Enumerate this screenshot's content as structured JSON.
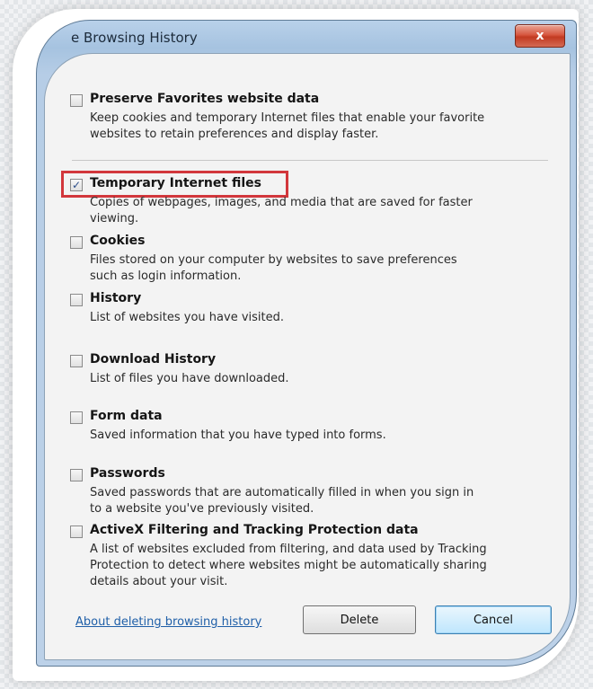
{
  "window": {
    "title": "e Browsing History",
    "close_label": "x"
  },
  "options": [
    {
      "label": "Preserve Favorites website data",
      "description": "Keep cookies and temporary Internet files that enable your favorite\nwebsites to retain preferences and display faster.",
      "checked": false
    },
    {
      "label": "Temporary Internet files",
      "description": "Copies of webpages, images, and media that are saved for faster\nviewing.",
      "checked": true
    },
    {
      "label": "Cookies",
      "description": "Files stored on your computer by websites to save preferences\nsuch as login information.",
      "checked": false
    },
    {
      "label": "History",
      "description": "List of websites you have visited.",
      "checked": false
    },
    {
      "label": "Download History",
      "description": "List of files you have downloaded.",
      "checked": false
    },
    {
      "label": "Form data",
      "description": "Saved information that you have typed into forms.",
      "checked": false
    },
    {
      "label": "Passwords",
      "description": "Saved passwords that are automatically filled in when you sign in\nto a website you've previously visited.",
      "checked": false
    },
    {
      "label": "ActiveX Filtering and Tracking Protection data",
      "description": "A list of websites excluded from filtering, and data used by Tracking\nProtection to detect where websites might be automatically sharing\ndetails about your visit.",
      "checked": false
    }
  ],
  "footer": {
    "about_link": "About deleting browsing history",
    "delete_label": "Delete",
    "cancel_label": "Cancel"
  },
  "colors": {
    "highlight": "#d2373c",
    "link": "#1f5fa8"
  }
}
